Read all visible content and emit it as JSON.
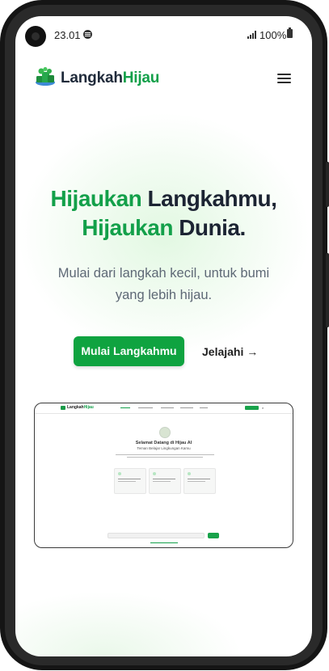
{
  "status_bar": {
    "time": "23.01",
    "battery": "100%"
  },
  "header": {
    "brand_main": "Langkah",
    "brand_accent": "Hijau"
  },
  "hero": {
    "title_line1_accent": "Hijaukan",
    "title_line1_rest": " Langkahmu,",
    "title_line2_accent": "Hijaukan",
    "title_line2_rest": " Dunia.",
    "subtitle": "Mulai dari langkah kecil, untuk bumi yang lebih hijau.",
    "primary_button": "Mulai Langkahmu",
    "secondary_link": "Jelajahi →"
  },
  "preview": {
    "brand_main": "Langkah",
    "brand_accent": "Hijau",
    "welcome_title": "Selamat Datang di Hijau AI",
    "welcome_subtitle": "Teman Belajar Lingkungan Kamu"
  },
  "colors": {
    "accent": "#13a04a",
    "button": "#0fa340",
    "text_dark": "#1c2433"
  }
}
